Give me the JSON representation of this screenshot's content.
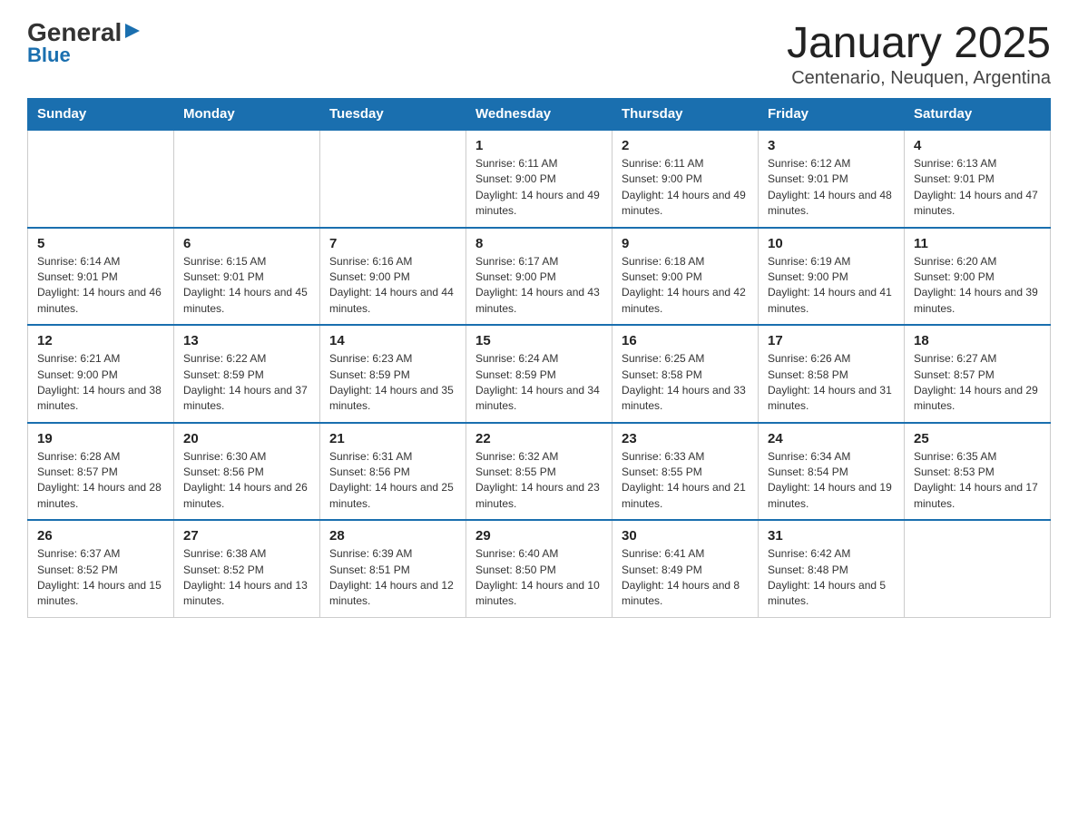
{
  "logo": {
    "general": "General",
    "blue": "Blue"
  },
  "title": "January 2025",
  "subtitle": "Centenario, Neuquen, Argentina",
  "days_of_week": [
    "Sunday",
    "Monday",
    "Tuesday",
    "Wednesday",
    "Thursday",
    "Friday",
    "Saturday"
  ],
  "weeks": [
    [
      {
        "day": "",
        "info": ""
      },
      {
        "day": "",
        "info": ""
      },
      {
        "day": "",
        "info": ""
      },
      {
        "day": "1",
        "info": "Sunrise: 6:11 AM\nSunset: 9:00 PM\nDaylight: 14 hours and 49 minutes."
      },
      {
        "day": "2",
        "info": "Sunrise: 6:11 AM\nSunset: 9:00 PM\nDaylight: 14 hours and 49 minutes."
      },
      {
        "day": "3",
        "info": "Sunrise: 6:12 AM\nSunset: 9:01 PM\nDaylight: 14 hours and 48 minutes."
      },
      {
        "day": "4",
        "info": "Sunrise: 6:13 AM\nSunset: 9:01 PM\nDaylight: 14 hours and 47 minutes."
      }
    ],
    [
      {
        "day": "5",
        "info": "Sunrise: 6:14 AM\nSunset: 9:01 PM\nDaylight: 14 hours and 46 minutes."
      },
      {
        "day": "6",
        "info": "Sunrise: 6:15 AM\nSunset: 9:01 PM\nDaylight: 14 hours and 45 minutes."
      },
      {
        "day": "7",
        "info": "Sunrise: 6:16 AM\nSunset: 9:00 PM\nDaylight: 14 hours and 44 minutes."
      },
      {
        "day": "8",
        "info": "Sunrise: 6:17 AM\nSunset: 9:00 PM\nDaylight: 14 hours and 43 minutes."
      },
      {
        "day": "9",
        "info": "Sunrise: 6:18 AM\nSunset: 9:00 PM\nDaylight: 14 hours and 42 minutes."
      },
      {
        "day": "10",
        "info": "Sunrise: 6:19 AM\nSunset: 9:00 PM\nDaylight: 14 hours and 41 minutes."
      },
      {
        "day": "11",
        "info": "Sunrise: 6:20 AM\nSunset: 9:00 PM\nDaylight: 14 hours and 39 minutes."
      }
    ],
    [
      {
        "day": "12",
        "info": "Sunrise: 6:21 AM\nSunset: 9:00 PM\nDaylight: 14 hours and 38 minutes."
      },
      {
        "day": "13",
        "info": "Sunrise: 6:22 AM\nSunset: 8:59 PM\nDaylight: 14 hours and 37 minutes."
      },
      {
        "day": "14",
        "info": "Sunrise: 6:23 AM\nSunset: 8:59 PM\nDaylight: 14 hours and 35 minutes."
      },
      {
        "day": "15",
        "info": "Sunrise: 6:24 AM\nSunset: 8:59 PM\nDaylight: 14 hours and 34 minutes."
      },
      {
        "day": "16",
        "info": "Sunrise: 6:25 AM\nSunset: 8:58 PM\nDaylight: 14 hours and 33 minutes."
      },
      {
        "day": "17",
        "info": "Sunrise: 6:26 AM\nSunset: 8:58 PM\nDaylight: 14 hours and 31 minutes."
      },
      {
        "day": "18",
        "info": "Sunrise: 6:27 AM\nSunset: 8:57 PM\nDaylight: 14 hours and 29 minutes."
      }
    ],
    [
      {
        "day": "19",
        "info": "Sunrise: 6:28 AM\nSunset: 8:57 PM\nDaylight: 14 hours and 28 minutes."
      },
      {
        "day": "20",
        "info": "Sunrise: 6:30 AM\nSunset: 8:56 PM\nDaylight: 14 hours and 26 minutes."
      },
      {
        "day": "21",
        "info": "Sunrise: 6:31 AM\nSunset: 8:56 PM\nDaylight: 14 hours and 25 minutes."
      },
      {
        "day": "22",
        "info": "Sunrise: 6:32 AM\nSunset: 8:55 PM\nDaylight: 14 hours and 23 minutes."
      },
      {
        "day": "23",
        "info": "Sunrise: 6:33 AM\nSunset: 8:55 PM\nDaylight: 14 hours and 21 minutes."
      },
      {
        "day": "24",
        "info": "Sunrise: 6:34 AM\nSunset: 8:54 PM\nDaylight: 14 hours and 19 minutes."
      },
      {
        "day": "25",
        "info": "Sunrise: 6:35 AM\nSunset: 8:53 PM\nDaylight: 14 hours and 17 minutes."
      }
    ],
    [
      {
        "day": "26",
        "info": "Sunrise: 6:37 AM\nSunset: 8:52 PM\nDaylight: 14 hours and 15 minutes."
      },
      {
        "day": "27",
        "info": "Sunrise: 6:38 AM\nSunset: 8:52 PM\nDaylight: 14 hours and 13 minutes."
      },
      {
        "day": "28",
        "info": "Sunrise: 6:39 AM\nSunset: 8:51 PM\nDaylight: 14 hours and 12 minutes."
      },
      {
        "day": "29",
        "info": "Sunrise: 6:40 AM\nSunset: 8:50 PM\nDaylight: 14 hours and 10 minutes."
      },
      {
        "day": "30",
        "info": "Sunrise: 6:41 AM\nSunset: 8:49 PM\nDaylight: 14 hours and 8 minutes."
      },
      {
        "day": "31",
        "info": "Sunrise: 6:42 AM\nSunset: 8:48 PM\nDaylight: 14 hours and 5 minutes."
      },
      {
        "day": "",
        "info": ""
      }
    ]
  ]
}
